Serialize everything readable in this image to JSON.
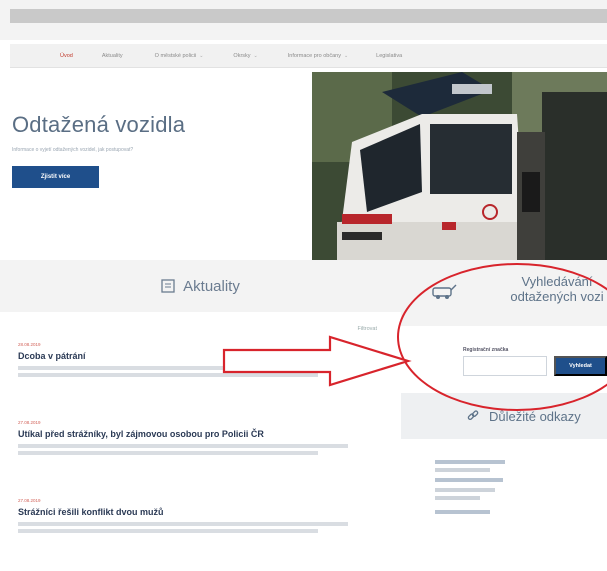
{
  "nav": {
    "items": [
      {
        "label": "Úvod",
        "active": true,
        "has_dropdown": false
      },
      {
        "label": "Aktuality",
        "active": false,
        "has_dropdown": false
      },
      {
        "label": "O městské policii",
        "active": false,
        "has_dropdown": true
      },
      {
        "label": "Okrsky",
        "active": false,
        "has_dropdown": true
      },
      {
        "label": "Informace pro občany",
        "active": false,
        "has_dropdown": true
      },
      {
        "label": "Legislativa",
        "active": false,
        "has_dropdown": false
      }
    ]
  },
  "hero": {
    "title": "Odtažená vozidla",
    "subtitle": "Informace o vyjetí odtažených vozidel, jak postupovat?",
    "cta_label": "Zjistit více"
  },
  "aktuality": {
    "heading": "Aktuality",
    "filter_label": "Filtrovat",
    "news": [
      {
        "date": "28.08.2019",
        "title": "Dcoba v pátrání"
      },
      {
        "date": "27.08.2019",
        "title": "Utíkal před strážníky, byl zájmovou osobou pro Policii ČR"
      },
      {
        "date": "27.08.2019",
        "title": "Strážníci řešili konflikt dvou mužů"
      }
    ]
  },
  "search": {
    "title_line1": "Vyhledávání",
    "title_line2": "odtažených vozi",
    "field_label": "Registrační značka",
    "button_label": "Vyhledat"
  },
  "links": {
    "heading": "Důležité odkazy"
  },
  "colors": {
    "brand_blue": "#1f4f8b",
    "annotation_red": "#d8242c",
    "active_nav": "#c0392b"
  }
}
